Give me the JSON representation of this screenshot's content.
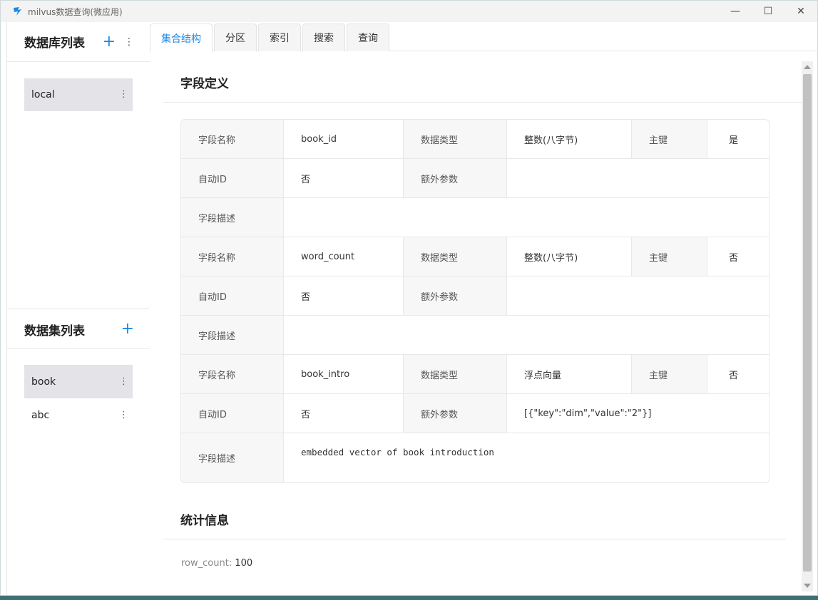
{
  "window": {
    "title": "milvus数据查询(微应用)",
    "controls": {
      "minimize": "—",
      "maximize": "☐",
      "close": "✕"
    }
  },
  "sidebar": {
    "databases": {
      "title": "数据库列表",
      "add": "+",
      "more": "⋮",
      "items": [
        {
          "label": "local",
          "more": "⋮"
        }
      ]
    },
    "collections": {
      "title": "数据集列表",
      "add": "+",
      "items": [
        {
          "label": "book",
          "more": "⋮"
        },
        {
          "label": "abc",
          "more": "⋮"
        }
      ]
    }
  },
  "tabs": [
    "集合结构",
    "分区",
    "索引",
    "搜索",
    "查询"
  ],
  "schema": {
    "title": "字段定义",
    "labels": {
      "name": "字段名称",
      "type": "数据类型",
      "pk": "主键",
      "auto_id": "自动ID",
      "params": "额外参数",
      "desc": "字段描述"
    },
    "fields": [
      {
        "name": "book_id",
        "type": "整数(八字节)",
        "pk": "是",
        "auto_id": "否",
        "params": "",
        "desc": ""
      },
      {
        "name": "word_count",
        "type": "整数(八字节)",
        "pk": "否",
        "auto_id": "否",
        "params": "",
        "desc": ""
      },
      {
        "name": "book_intro",
        "type": "浮点向量",
        "pk": "否",
        "auto_id": "否",
        "params": "[{\"key\":\"dim\",\"value\":\"2\"}]",
        "desc": "embedded vector of book introduction"
      }
    ]
  },
  "stats": {
    "title": "统计信息",
    "key": "row_count:",
    "value": "100"
  },
  "colors": {
    "accent": "#1e88e5",
    "label_bg": "#f7f7f7",
    "selected_bg": "#e4e4e8"
  }
}
